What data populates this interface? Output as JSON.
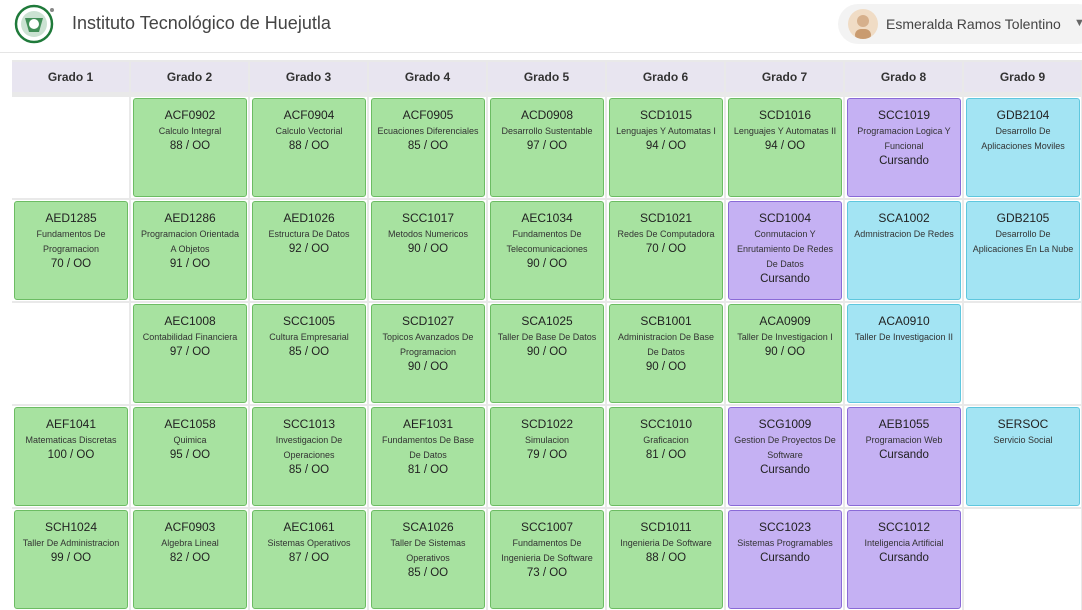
{
  "header": {
    "title": "Instituto Tecnológico de Huejutla",
    "user_name": "Esmeralda Ramos Tolentino"
  },
  "colors": {
    "aprobada": "#a7e2a0",
    "cursando": "#c5b1f3",
    "pendiente": "#a3e4f3"
  },
  "grades": [
    "Grado 1",
    "Grado 2",
    "Grado 3",
    "Grado 4",
    "Grado 5",
    "Grado 6",
    "Grado 7",
    "Grado 8",
    "Grado 9"
  ],
  "courses": [
    {
      "row": 0,
      "col": 1,
      "code": "ACF0902",
      "name": "Calculo Integral",
      "score": "88 / OO",
      "status": "green"
    },
    {
      "row": 0,
      "col": 2,
      "code": "ACF0904",
      "name": "Calculo Vectorial",
      "score": "88 / OO",
      "status": "green"
    },
    {
      "row": 0,
      "col": 3,
      "code": "ACF0905",
      "name": "Ecuaciones Diferenciales",
      "score": "85 / OO",
      "status": "green"
    },
    {
      "row": 0,
      "col": 4,
      "code": "ACD0908",
      "name": "Desarrollo Sustentable",
      "score": "97 / OO",
      "status": "green"
    },
    {
      "row": 0,
      "col": 5,
      "code": "SCD1015",
      "name": "Lenguajes Y Automatas I",
      "score": "94 / OO",
      "status": "green"
    },
    {
      "row": 0,
      "col": 6,
      "code": "SCD1016",
      "name": "Lenguajes Y Automatas II",
      "score": "94 / OO",
      "status": "green"
    },
    {
      "row": 0,
      "col": 7,
      "code": "SCC1019",
      "name": "Programacion Logica Y Funcional",
      "score": "Cursando",
      "status": "purple"
    },
    {
      "row": 0,
      "col": 8,
      "code": "GDB2104",
      "name": "Desarrollo De Aplicaciones Moviles",
      "score": "",
      "status": "blue"
    },
    {
      "row": 1,
      "col": 0,
      "code": "AED1285",
      "name": "Fundamentos De Programacion",
      "score": "70 / OO",
      "status": "green"
    },
    {
      "row": 1,
      "col": 1,
      "code": "AED1286",
      "name": "Programacion Orientada A Objetos",
      "score": "91 / OO",
      "status": "green"
    },
    {
      "row": 1,
      "col": 2,
      "code": "AED1026",
      "name": "Estructura De Datos",
      "score": "92 / OO",
      "status": "green"
    },
    {
      "row": 1,
      "col": 3,
      "code": "SCC1017",
      "name": "Metodos Numericos",
      "score": "90 / OO",
      "status": "green"
    },
    {
      "row": 1,
      "col": 4,
      "code": "AEC1034",
      "name": "Fundamentos De Telecomunicaciones",
      "score": "90 / OO",
      "status": "green"
    },
    {
      "row": 1,
      "col": 5,
      "code": "SCD1021",
      "name": "Redes De Computadora",
      "score": "70 / OO",
      "status": "green"
    },
    {
      "row": 1,
      "col": 6,
      "code": "SCD1004",
      "name": "Conmutacion Y Enrutamiento De Redes De Datos",
      "score": "Cursando",
      "status": "purple"
    },
    {
      "row": 1,
      "col": 7,
      "code": "SCA1002",
      "name": "Admnistracion De Redes",
      "score": "",
      "status": "blue"
    },
    {
      "row": 1,
      "col": 8,
      "code": "GDB2105",
      "name": "Desarrollo De Aplicaciones En La Nube",
      "score": "",
      "status": "blue"
    },
    {
      "row": 2,
      "col": 1,
      "code": "AEC1008",
      "name": "Contabilidad Financiera",
      "score": "97 / OO",
      "status": "green"
    },
    {
      "row": 2,
      "col": 2,
      "code": "SCC1005",
      "name": "Cultura Empresarial",
      "score": "85 / OO",
      "status": "green"
    },
    {
      "row": 2,
      "col": 3,
      "code": "SCD1027",
      "name": "Topicos Avanzados De Programacion",
      "score": "90 / OO",
      "status": "green"
    },
    {
      "row": 2,
      "col": 4,
      "code": "SCA1025",
      "name": "Taller De Base De Datos",
      "score": "90 / OO",
      "status": "green"
    },
    {
      "row": 2,
      "col": 5,
      "code": "SCB1001",
      "name": "Administracion De Base De Datos",
      "score": "90 / OO",
      "status": "green"
    },
    {
      "row": 2,
      "col": 6,
      "code": "ACA0909",
      "name": "Taller De Investigacion I",
      "score": "90 / OO",
      "status": "green"
    },
    {
      "row": 2,
      "col": 7,
      "code": "ACA0910",
      "name": "Taller De Investigacion II",
      "score": "",
      "status": "blue"
    },
    {
      "row": 3,
      "col": 0,
      "code": "AEF1041",
      "name": "Matematicas Discretas",
      "score": "100 / OO",
      "status": "green"
    },
    {
      "row": 3,
      "col": 1,
      "code": "AEC1058",
      "name": "Quimica",
      "score": "95 / OO",
      "status": "green"
    },
    {
      "row": 3,
      "col": 2,
      "code": "SCC1013",
      "name": "Investigacion De Operaciones",
      "score": "85 / OO",
      "status": "green"
    },
    {
      "row": 3,
      "col": 3,
      "code": "AEF1031",
      "name": "Fundamentos De Base De Datos",
      "score": "81 / OO",
      "status": "green"
    },
    {
      "row": 3,
      "col": 4,
      "code": "SCD1022",
      "name": "Simulacion",
      "score": "79 / OO",
      "status": "green"
    },
    {
      "row": 3,
      "col": 5,
      "code": "SCC1010",
      "name": "Graficacion",
      "score": "81 / OO",
      "status": "green"
    },
    {
      "row": 3,
      "col": 6,
      "code": "SCG1009",
      "name": "Gestion De Proyectos De Software",
      "score": "Cursando",
      "status": "purple"
    },
    {
      "row": 3,
      "col": 7,
      "code": "AEB1055",
      "name": "Programacion Web",
      "score": "Cursando",
      "status": "purple"
    },
    {
      "row": 3,
      "col": 8,
      "code": "SERSOC",
      "name": "Servicio Social",
      "score": "",
      "status": "blue"
    },
    {
      "row": 4,
      "col": 0,
      "code": "SCH1024",
      "name": "Taller De Administracion",
      "score": "99 / OO",
      "status": "green"
    },
    {
      "row": 4,
      "col": 1,
      "code": "ACF0903",
      "name": "Algebra Lineal",
      "score": "82 / OO",
      "status": "green"
    },
    {
      "row": 4,
      "col": 2,
      "code": "AEC1061",
      "name": "Sistemas Operativos",
      "score": "87 / OO",
      "status": "green"
    },
    {
      "row": 4,
      "col": 3,
      "code": "SCA1026",
      "name": "Taller De Sistemas Operativos",
      "score": "85 / OO",
      "status": "green"
    },
    {
      "row": 4,
      "col": 4,
      "code": "SCC1007",
      "name": "Fundamentos De Ingenieria De Software",
      "score": "73 / OO",
      "status": "green"
    },
    {
      "row": 4,
      "col": 5,
      "code": "SCD1011",
      "name": "Ingenieria De Software",
      "score": "88 / OO",
      "status": "green"
    },
    {
      "row": 4,
      "col": 6,
      "code": "SCC1023",
      "name": "Sistemas Programables",
      "score": "Cursando",
      "status": "purple"
    },
    {
      "row": 4,
      "col": 7,
      "code": "SCC1012",
      "name": "Inteligencia Artificial",
      "score": "Cursando",
      "status": "purple"
    }
  ]
}
